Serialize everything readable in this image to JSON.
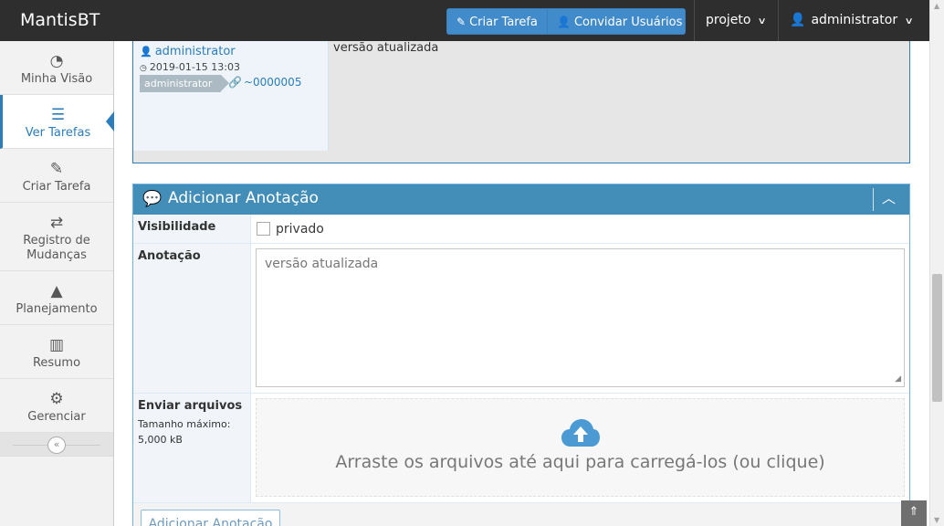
{
  "navbar": {
    "brand": "MantisBT",
    "create_issue": "Criar Tarefa",
    "invite_users": "Convidar Usuários",
    "project": "projeto",
    "user": "administrator"
  },
  "sidebar": {
    "items": [
      {
        "label": "Minha Visão",
        "icon": "dashboard-icon",
        "glyph": "◔"
      },
      {
        "label": "Ver Tarefas",
        "icon": "list-icon",
        "glyph": "☰"
      },
      {
        "label": "Criar Tarefa",
        "icon": "edit-icon",
        "glyph": "✎"
      },
      {
        "label": "Registro de Mudanças",
        "icon": "retweet-icon",
        "glyph": "⇄"
      },
      {
        "label": "Planejamento",
        "icon": "road-icon",
        "glyph": "▲"
      },
      {
        "label": "Resumo",
        "icon": "bar-chart-icon",
        "glyph": "▥"
      },
      {
        "label": "Gerenciar",
        "icon": "gears-icon",
        "glyph": "⚙"
      }
    ],
    "collapse_glyph": "«"
  },
  "note": {
    "author": "administrator",
    "date": "2019-01-15 13:03",
    "role": "administrator",
    "link": "~0000005",
    "text": "versão atualizada"
  },
  "form": {
    "title": "Adicionar Anotação",
    "visibility_label": "Visibilidade",
    "private_label": "privado",
    "note_label": "Anotação",
    "note_value": "versão atualizada",
    "upload_label": "Enviar arquivos",
    "max_size_label": "Tamanho máximo:",
    "max_size_value": "5,000 kB",
    "dropzone_text": "Arraste os arquivos até aqui para carregá-los (ou clique)",
    "submit_label": "Adicionar Anotação"
  },
  "colors": {
    "accent": "#438eb9",
    "navbar": "#2e2e2e",
    "primary_button": "#428bca"
  }
}
